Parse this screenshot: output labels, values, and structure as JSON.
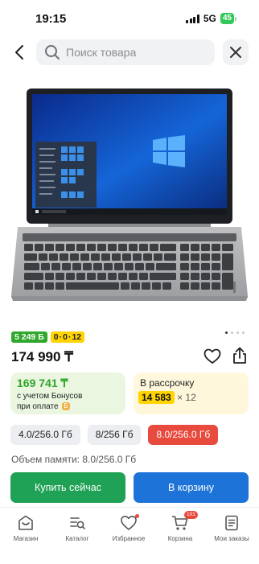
{
  "status_bar": {
    "time": "19:15",
    "network": "5G",
    "battery": "45"
  },
  "search": {
    "placeholder": "Поиск товара"
  },
  "product": {
    "badge_green": "5 249 Б",
    "badge_yellow": [
      "0",
      "0",
      "12"
    ],
    "price": "174 990 ₸"
  },
  "bonus_card": {
    "amount": "169 741 ₸",
    "line1": "с учетом Бонусов",
    "line2": "при оплате",
    "icon_text": "Б"
  },
  "installment_card": {
    "title": "В рассрочку",
    "monthly": "14 583",
    "months": "× 12"
  },
  "variants": [
    {
      "label": "4.0/256.0 Гб",
      "selected": false
    },
    {
      "label": "8/256 Гб",
      "selected": false
    },
    {
      "label": "8.0/256.0 Гб",
      "selected": true
    }
  ],
  "memory": {
    "label": "Объем памяти:",
    "value": "8.0/256.0 Гб"
  },
  "actions": {
    "buy": "Купить сейчас",
    "cart": "В корзину"
  },
  "tabbar": {
    "items": [
      {
        "label": "Магазин",
        "icon": "shop-icon"
      },
      {
        "label": "Каталог",
        "icon": "catalog-icon"
      },
      {
        "label": "Избранное",
        "icon": "heart-icon"
      },
      {
        "label": "Корзина",
        "icon": "cart-icon",
        "badge": "101"
      },
      {
        "label": "Мои заказы",
        "icon": "orders-icon"
      }
    ]
  },
  "colors": {
    "green": "#1fa255",
    "blue": "#1e73d8",
    "red": "#e84a3e",
    "yellow": "#ffd400"
  }
}
